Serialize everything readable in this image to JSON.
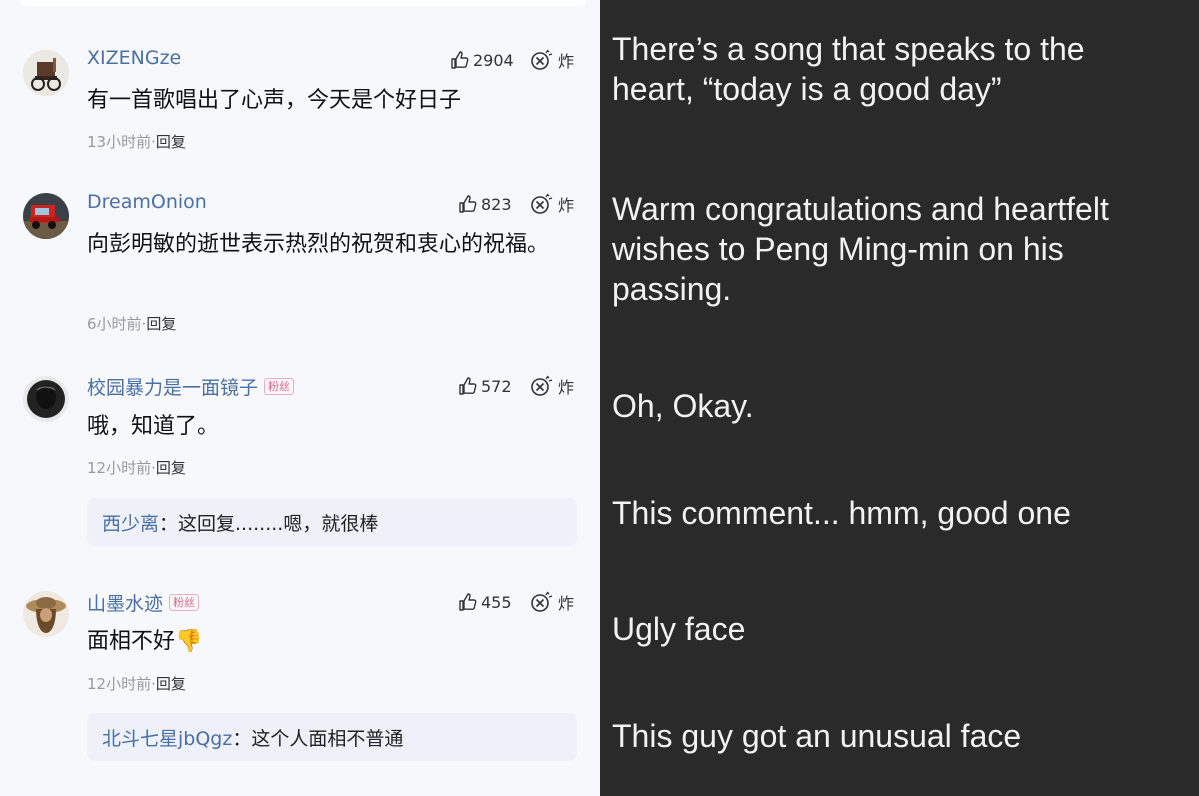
{
  "comments": [
    {
      "user": "XIZENGze",
      "likes": "2904",
      "boom": "炸",
      "text": "有一首歌唱出了心声，今天是个好日子",
      "time": "13小时前",
      "sep": "·",
      "reply": "回复",
      "translation": "There’s a song that speaks to the heart, “today is a good day”",
      "avatar_icon": "wheelchair-avatar"
    },
    {
      "user": "DreamOnion",
      "likes": "823",
      "boom": "炸",
      "text": "向彭明敏的逝世表示热烈的祝贺和衷心的祝福。",
      "time": "6小时前",
      "sep": "·",
      "reply": "回复",
      "translation": "Warm congratulations and heartfelt wishes to Peng Ming-min on his passing.",
      "avatar_icon": "truck-avatar"
    },
    {
      "user": "校园暴力是一面镜子",
      "badge": "粉丝",
      "likes": "572",
      "boom": "炸",
      "text": "哦，知道了。",
      "time": "12小时前",
      "sep": "·",
      "reply": "回复",
      "translation": "Oh, Okay.",
      "avatar_icon": "mask-avatar",
      "sub_reply": {
        "user": "西少离",
        "text": "：这回复........嗯，就很棒",
        "translation": "This comment... hmm, good one"
      }
    },
    {
      "user": "山墨水迹",
      "badge": "粉丝",
      "likes": "455",
      "boom": "炸",
      "text": "面相不好",
      "emoji": "👎",
      "time": "12小时前",
      "sep": "·",
      "reply": "回复",
      "translation": "Ugly face",
      "avatar_icon": "hat-avatar",
      "sub_reply": {
        "user": "北斗七星jbQgz",
        "text": "：这个人面相不普通",
        "translation": "This guy got an unusual face"
      }
    }
  ]
}
